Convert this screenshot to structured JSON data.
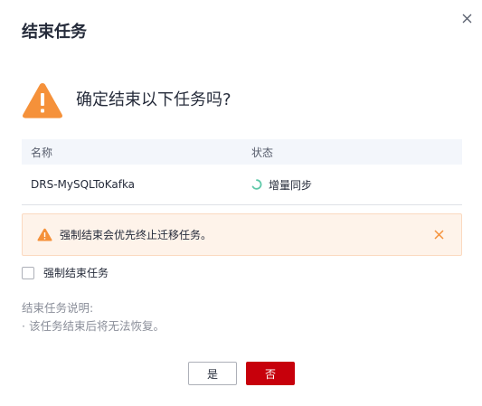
{
  "dialog": {
    "title": "结束任务",
    "question": "确定结束以下任务吗?",
    "table": {
      "headers": [
        "名称",
        "状态"
      ],
      "rows": [
        {
          "name": "DRS-MySQLToKafka",
          "status": "增量同步"
        }
      ]
    },
    "alert": {
      "text": "强制结束会优先终止迁移任务。"
    },
    "force_checkbox": {
      "label": "强制结束任务",
      "checked": false
    },
    "description": {
      "title": "结束任务说明:",
      "items": [
        "· 该任务结束后将无法恢复。"
      ]
    },
    "buttons": {
      "yes": "是",
      "no": "否"
    }
  },
  "colors": {
    "warning_orange": "#f5913a",
    "primary_red": "#c7000b",
    "status_green": "#5ec8a8",
    "alert_bg": "#fef3ea"
  },
  "icons": {
    "close": "close-icon",
    "warning": "warning-triangle-icon",
    "status": "loading-spinner-icon"
  }
}
